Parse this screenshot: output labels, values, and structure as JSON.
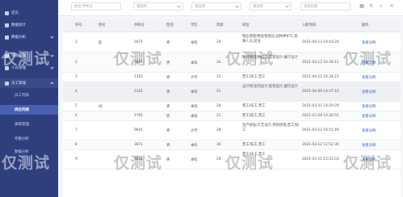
{
  "sidebar": {
    "items": [
      {
        "label": "首页"
      },
      {
        "label": "数据统计"
      },
      {
        "label": "数据分析"
      },
      {
        "label": "线路管理"
      },
      {
        "label": "人员管理"
      }
    ],
    "group": {
      "label": "员工管理"
    },
    "subitems": [
      {
        "label": "员工列表"
      },
      {
        "label": "岗位列表"
      },
      {
        "label": "离职管理"
      },
      {
        "label": "考勤分析"
      },
      {
        "label": "数据分析"
      }
    ]
  },
  "filters": {
    "search_placeholder": "姓名/手机号",
    "select1_placeholder": "请选择",
    "select2_placeholder": "请选择",
    "select3_placeholder": "请选择",
    "date_placeholder": "开始日期"
  },
  "table": {
    "columns": [
      "序号",
      "姓名",
      "手机号",
      "性别",
      "学历",
      "年龄",
      "岗位",
      "入职时间",
      "操作"
    ],
    "rows": [
      {
        "no": "1",
        "name": "彭",
        "phone": "1871",
        "gender": "男",
        "edu": "本科",
        "age": "29",
        "post": "物业管理/物业管理员,园林养护工,客服人员,前台",
        "date": "2021-04-13 14:43:24",
        "action": "查看详情"
      },
      {
        "no": "2",
        "name": "",
        "phone": "1891",
        "gender": "男",
        "edu": "本科",
        "age": "24",
        "post": "设计师/室内设计,软装设计,展厅设计",
        "date": "2021-04-12 16:34:12",
        "action": "查看详情"
      },
      {
        "no": "3",
        "name": "",
        "phone": "1362",
        "gender": "男",
        "edu": "大专",
        "age": "21",
        "post": "普工/技工,普工",
        "date": "2021-04-12 16:34:21",
        "action": "查看详情"
      },
      {
        "no": "4",
        "name": "",
        "phone": "2101",
        "gender": "男",
        "edu": "本科",
        "age": "21",
        "post": "设计师/室内设计,软装设计,展厅设计",
        "date": "2021-04-09 14:37:10",
        "action": "查看详情"
      },
      {
        "no": "5",
        "name": "试",
        "phone": "",
        "gender": "男",
        "edu": "本科",
        "age": "26",
        "post": "普工/技工,普工",
        "date": "2021-03-31 14:20:29",
        "action": "查看详情"
      },
      {
        "no": "6",
        "name": "",
        "phone": "1791",
        "gender": "男",
        "edu": "本科",
        "age": "21",
        "post": "普工/技工,普工",
        "date": "2021-03-28 14:26:52",
        "action": "查看详情"
      },
      {
        "no": "7",
        "name": "",
        "phone": "9601",
        "gender": "男",
        "edu": "大专",
        "age": "28",
        "post": "生产研发/工艺设计,项目经理,普工/技工",
        "date": "2021-03-12 16:51:49",
        "action": "查看详情"
      },
      {
        "no": "8",
        "name": "",
        "phone": "3871",
        "gender": "男",
        "edu": "本科",
        "age": "36",
        "post": "普工/技工,普工",
        "date": "2021-03-12 12:52:30",
        "action": "查看详情"
      },
      {
        "no": "9",
        "name": "",
        "phone": "9831",
        "gender": "男",
        "edu": "本科",
        "age": "29",
        "post": "普工/技工,普工",
        "date": "2021-03-11 15:21:03",
        "action": "查看详情"
      }
    ]
  },
  "watermark": {
    "text": "仅测试"
  }
}
